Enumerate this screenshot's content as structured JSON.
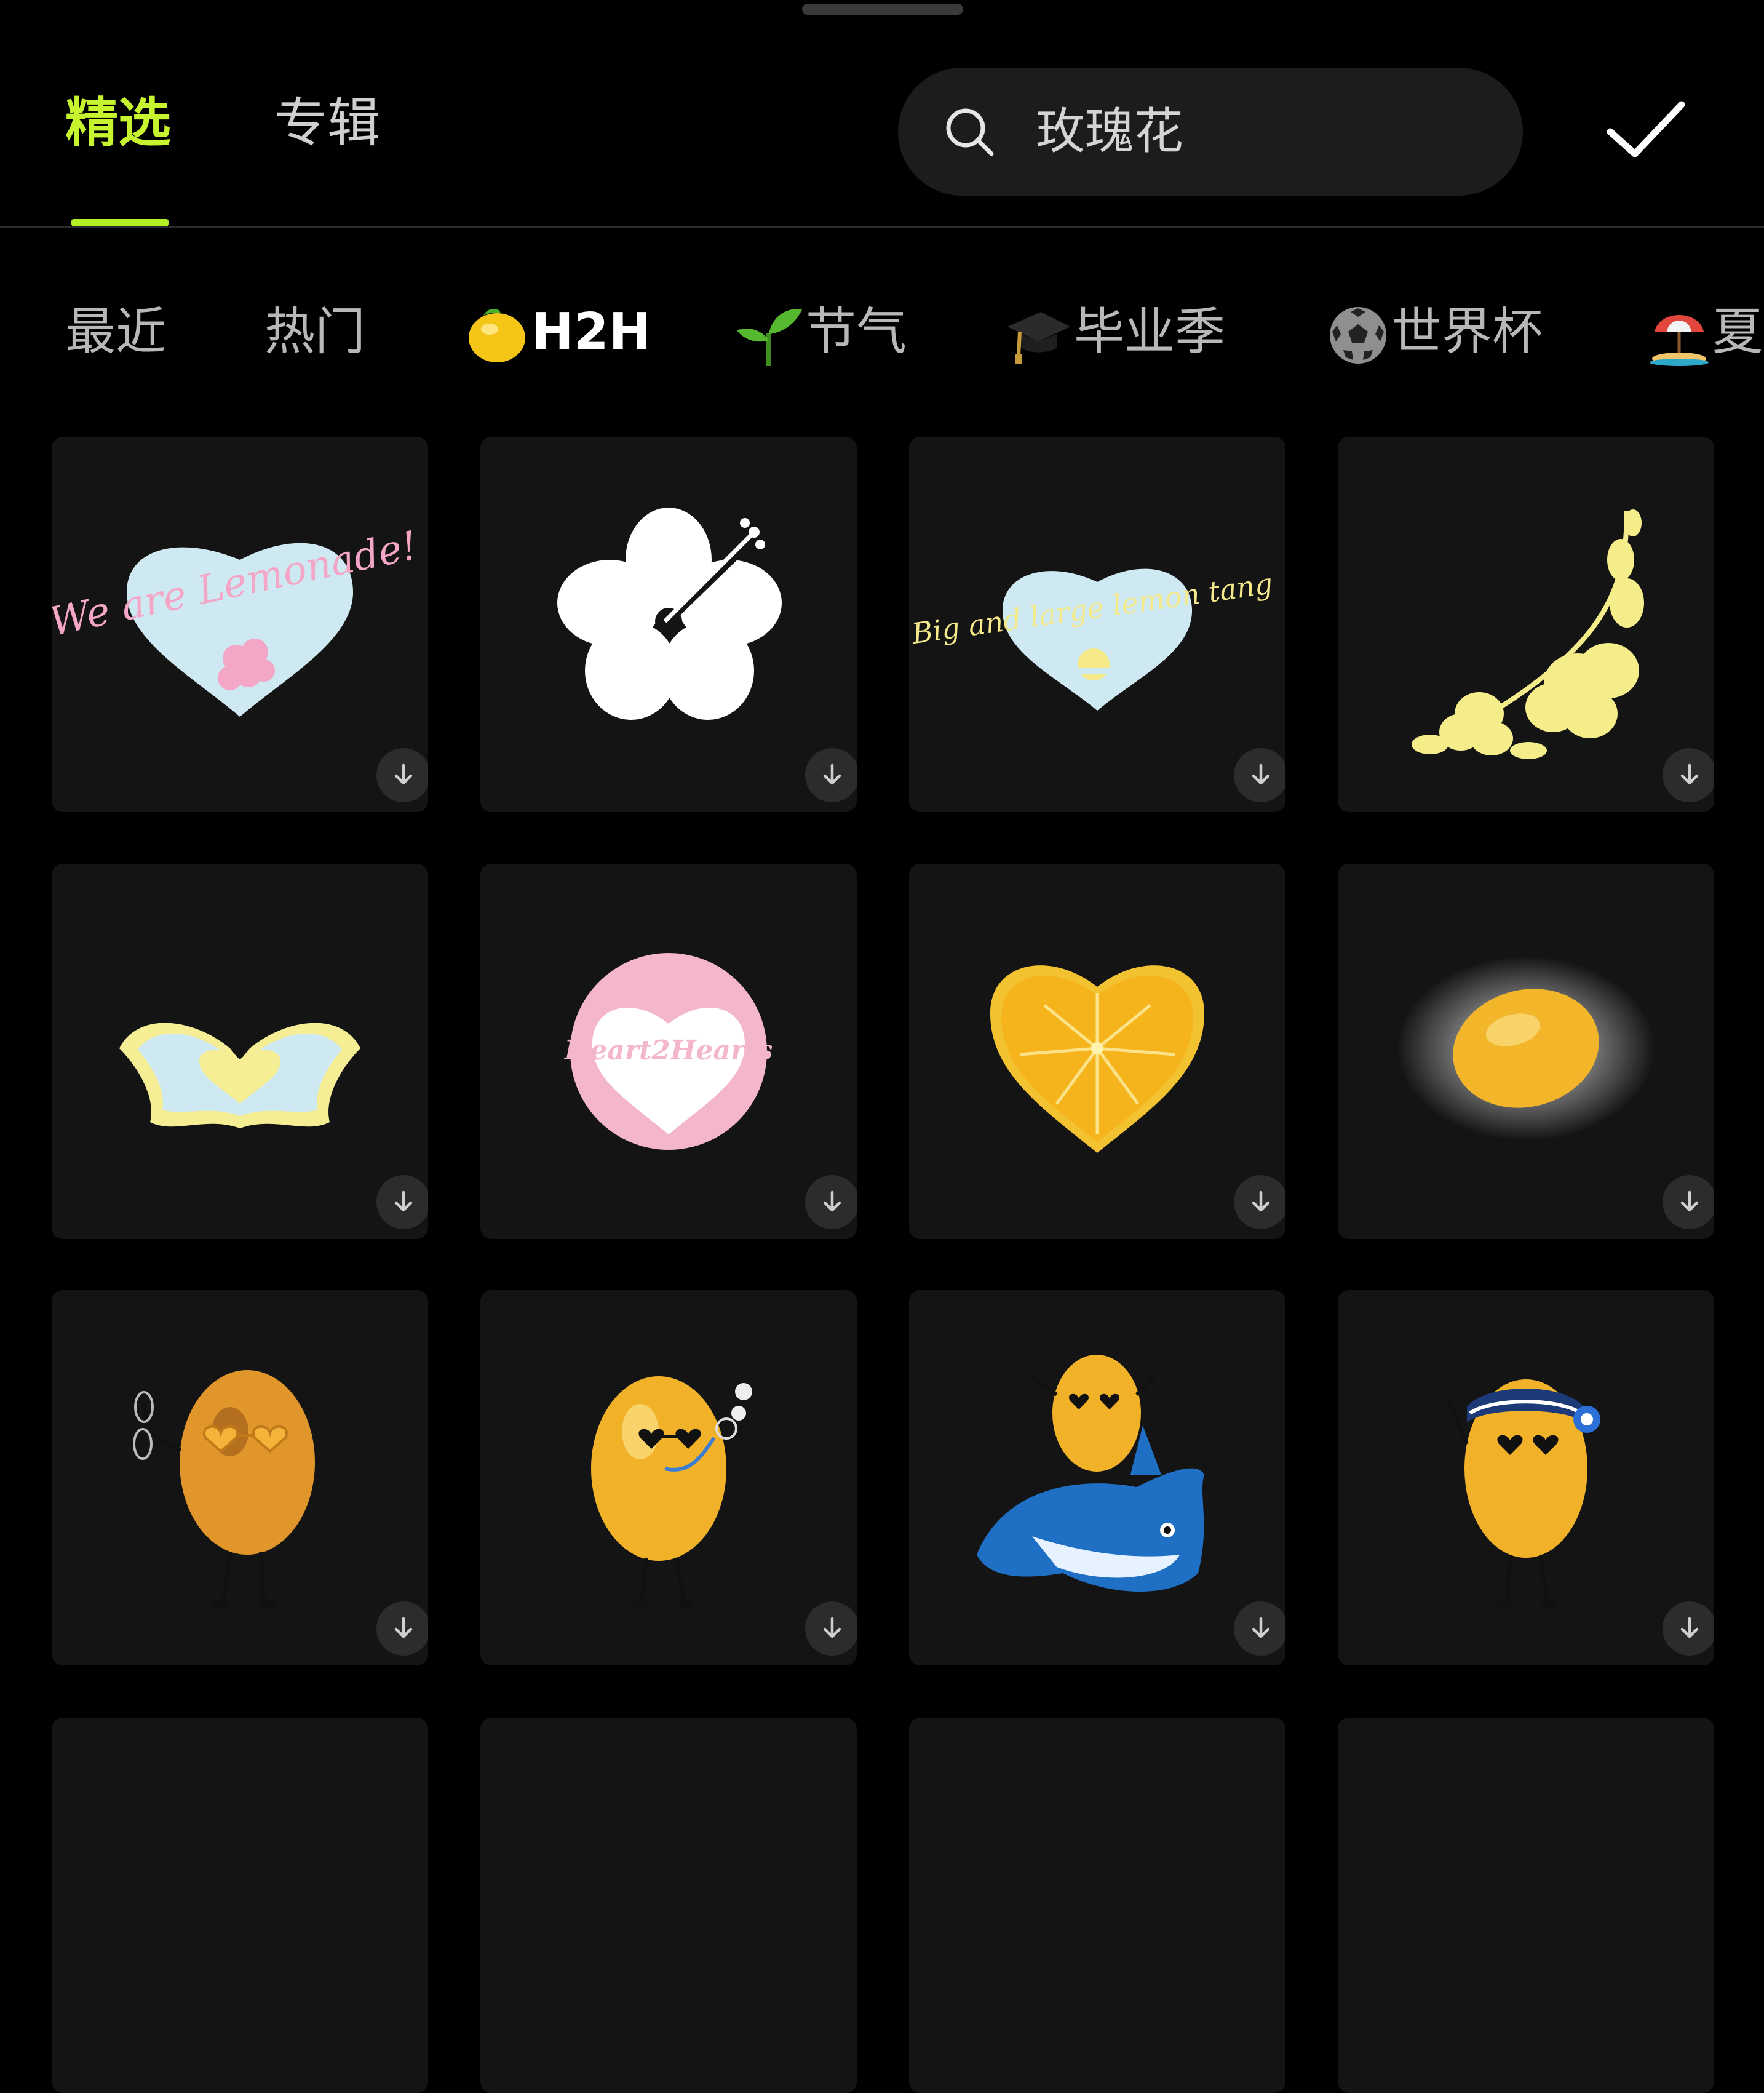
{
  "tabs": [
    {
      "label": "精选",
      "active": true
    },
    {
      "label": "专辑",
      "active": false
    }
  ],
  "search": {
    "text": "玫瑰花",
    "icon": "search-icon"
  },
  "confirm_icon": "check-icon",
  "categories": [
    {
      "label": "最近",
      "emoji": ""
    },
    {
      "label": "热门",
      "emoji": ""
    },
    {
      "label": "H2H",
      "emoji": "lemon-icon",
      "active": true
    },
    {
      "label": "节气",
      "emoji": "sprout-icon"
    },
    {
      "label": "毕业季",
      "emoji": "graduation-cap-icon"
    },
    {
      "label": "世界杯",
      "emoji": "soccer-ball-icon"
    },
    {
      "label": "夏",
      "emoji": "beach-umbrella-icon"
    }
  ],
  "stickers": [
    {
      "name": "we-are-lemonade-heart",
      "text": "We are Lemonade!"
    },
    {
      "name": "white-hibiscus"
    },
    {
      "name": "big-and-large-lemon-tang-heart",
      "text": "Big and large lemon tang"
    },
    {
      "name": "yellow-hibiscus-corner"
    },
    {
      "name": "dolphin-heart"
    },
    {
      "name": "heart2heart-badge",
      "text": "Heart2Hearts"
    },
    {
      "name": "lemon-slice-heart"
    },
    {
      "name": "glowing-lemon"
    },
    {
      "name": "lemon-character-heart-glasses"
    },
    {
      "name": "lemon-character-bubbles"
    },
    {
      "name": "lemon-character-on-orca-float"
    },
    {
      "name": "lemon-character-headband"
    }
  ],
  "download_icon": "download-icon",
  "colors": {
    "accent": "#b4f126",
    "tile": "#141414",
    "background": "#000000"
  }
}
